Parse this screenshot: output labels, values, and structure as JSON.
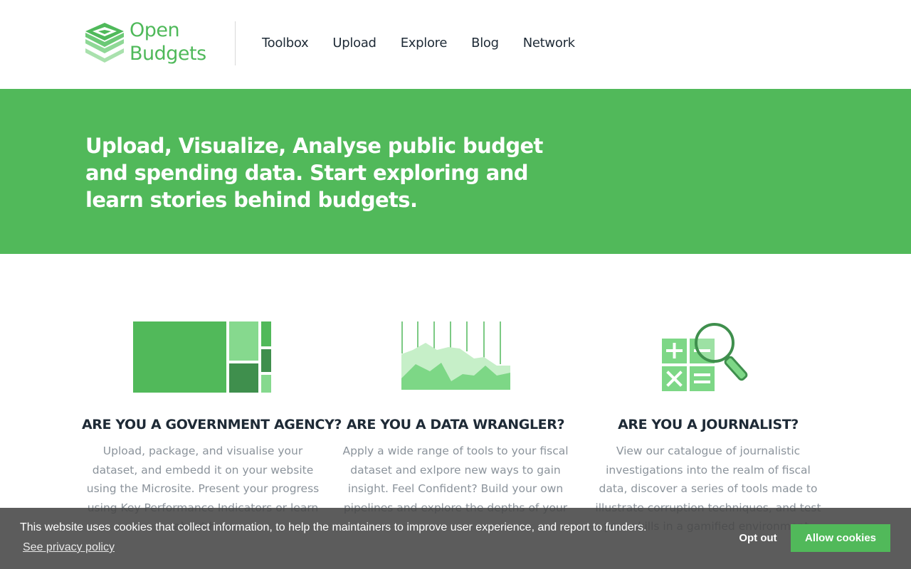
{
  "brand": {
    "line1": "Open",
    "line2": "Budgets",
    "icon": "stacked-layers-logo",
    "color": "#4fb95a"
  },
  "nav": {
    "items": [
      {
        "label": "Toolbox"
      },
      {
        "label": "Upload"
      },
      {
        "label": "Explore"
      },
      {
        "label": "Blog"
      },
      {
        "label": "Network"
      }
    ]
  },
  "hero": {
    "headline": "Upload, Visualize, Analyse public budget and spending data. Start exploring and learn stories behind budgets.",
    "background": "#51b95a"
  },
  "features": [
    {
      "icon": "treemap-icon",
      "title": "ARE YOU A GOVERNMENT AGENCY?",
      "text": "Upload, package, and visualise your dataset, and embedd it on your website using the Microsite. Present your progress using Key Performance Indicators or learn about how"
    },
    {
      "icon": "area-chart-icon",
      "title": "ARE YOU A DATA WRANGLER?",
      "text": "Apply a wide range of tools to your fiscal dataset and exlpore new ways to gain insight. Feel Confident? Build your own pipelines and explore the depths of your"
    },
    {
      "icon": "calculator-magnifier-icon",
      "title": "ARE YOU A JOURNALIST?",
      "text": "View our catalogue of journalistic investigations into the realm of fiscal data, discover a series of tools made to illustrate corruption techniques, and test your skills in a gamified environment."
    }
  ],
  "cookie_banner": {
    "message": "This website uses cookies that collect information, to help the maintainers to improve user experience, and report to funders.",
    "link": "See privacy policy",
    "opt_out": "Opt out",
    "allow": "Allow cookies"
  }
}
